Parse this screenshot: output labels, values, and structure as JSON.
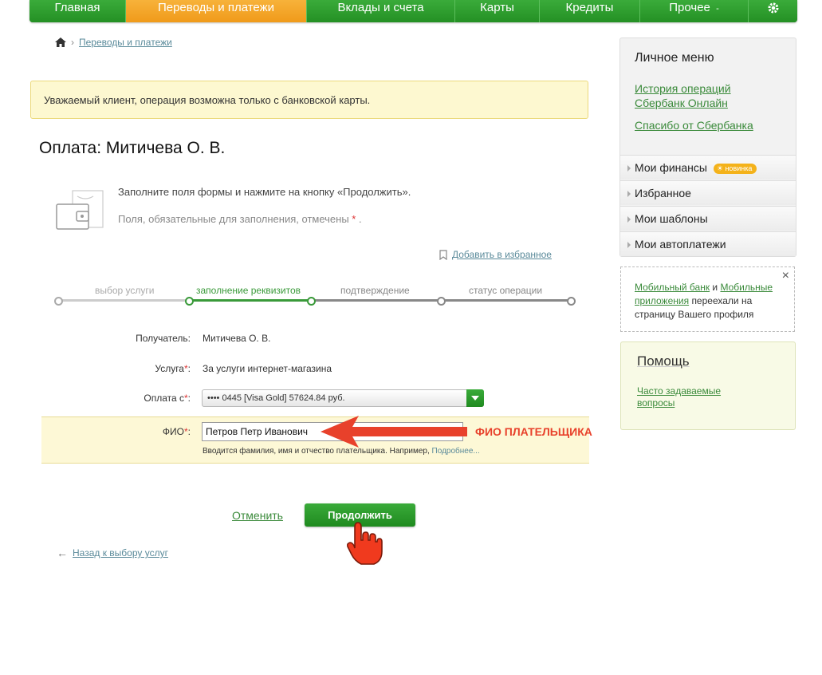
{
  "nav": {
    "items": [
      "Главная",
      "Переводы и платежи",
      "Вклады и счета",
      "Карты",
      "Кредиты",
      "Прочее",
      "gear-icon"
    ],
    "more_suffix": "-",
    "active_color": "#f5a623",
    "brand_color": "#2c9a2c"
  },
  "breadcrumb": {
    "home_icon": "home-icon",
    "current": "Переводы и платежи"
  },
  "alert": {
    "text": "Уважаемый клиент, операция возможна только с банковской карты."
  },
  "page": {
    "title": "Оплата: Митичева О. В."
  },
  "hints": {
    "line1": "Заполните поля формы и нажмите на кнопку «Продолжить».",
    "line2": "Поля, обязательные для заполнения, отмечены",
    "required_mark": "*",
    "line2_end": "."
  },
  "favorites": {
    "label": "Добавить в избранное"
  },
  "steps": [
    "выбор услуги",
    "заполнение реквизитов",
    "подтверждение",
    "статус операции"
  ],
  "form": {
    "recipient_label": "Получатель:",
    "recipient_value": "Митичева О. В.",
    "service_label": "Услуга",
    "service_value": "За услуги интернет-магазина",
    "payfrom_label": "Оплата с",
    "payfrom_value": "•••• 0445 [Visa Gold] 57624.84 руб.",
    "fio_label": "ФИО",
    "fio_value": "Петров Петр Иванович",
    "fio_help": "Вводится фамилия, имя и отчество плательщика. Например,",
    "fio_help_link": "Подробнее...",
    "colon": ":",
    "required_mark": "*"
  },
  "annotation": {
    "text": "ФИО ПЛАТЕЛЬЩИКА"
  },
  "actions": {
    "cancel": "Отменить",
    "continue": "Продолжить",
    "back": "Назад к выбору услуг"
  },
  "sidebar": {
    "title": "Личное меню",
    "links": [
      "История операций",
      "Сбербанк Онлайн",
      "Спасибо от Сбербанка"
    ],
    "items": [
      "Мои финансы",
      "Избранное",
      "Мои шаблоны",
      "Мои автоплатежи"
    ],
    "badge": "новинка",
    "notice": {
      "link1": "Мобильный банк",
      "and": "и",
      "link2": "Мобильные приложения",
      "rest": "переехали на страницу Вашего профиля",
      "close": "×"
    },
    "help": {
      "title": "Помощь",
      "link": "Часто задаваемые вопросы"
    }
  }
}
